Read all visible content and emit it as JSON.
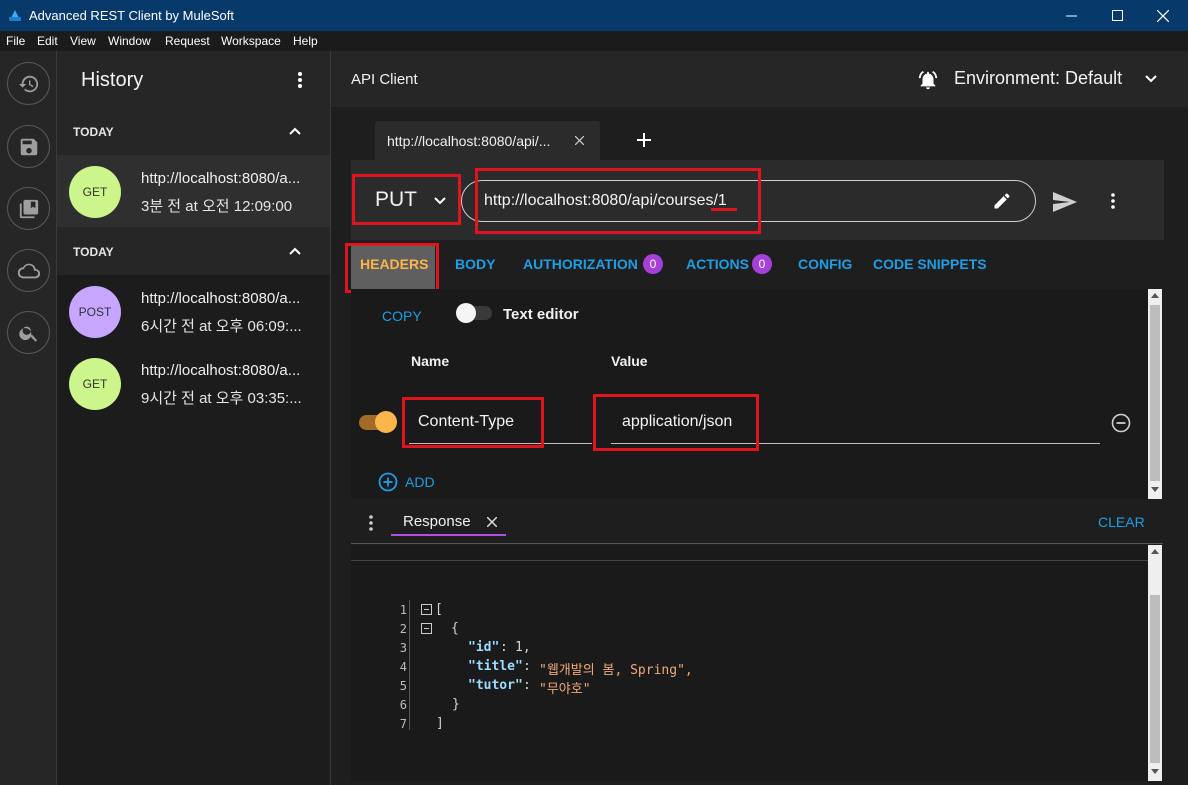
{
  "window": {
    "title": "Advanced REST Client by MuleSoft"
  },
  "menu": [
    "File",
    "Edit",
    "View",
    "Window",
    "Request",
    "Workspace",
    "Help"
  ],
  "history": {
    "title": "History",
    "sections": [
      {
        "label": "TODAY",
        "items": [
          {
            "method": "GET",
            "url": "http://localhost:8080/a...",
            "time": "3분 전 at 오전 12:09:00",
            "color": "#ccf58c"
          }
        ]
      },
      {
        "label": "TODAY",
        "items": [
          {
            "method": "POST",
            "url": "http://localhost:8080/a...",
            "time": "6시간 전 at 오후 06:09:...",
            "color": "#c6a6ff"
          },
          {
            "method": "GET",
            "url": "http://localhost:8080/a...",
            "time": "9시간 전 at 오후 03:35:...",
            "color": "#ccf58c"
          }
        ]
      }
    ]
  },
  "header": {
    "title": "API Client",
    "environment": "Environment: Default"
  },
  "tab": {
    "label": "http://localhost:8080/api/...",
    "add": "+"
  },
  "request": {
    "method": "PUT",
    "url": "http://localhost:8080/api/courses/1"
  },
  "request_tabs": [
    {
      "label": "HEADERS"
    },
    {
      "label": "BODY"
    },
    {
      "label": "AUTHORIZATION",
      "count": "0"
    },
    {
      "label": "ACTIONS",
      "count": "0"
    },
    {
      "label": "CONFIG"
    },
    {
      "label": "CODE SNIPPETS"
    }
  ],
  "headers_panel": {
    "copy": "COPY",
    "text_editor": "Text editor",
    "name_col": "Name",
    "value_col": "Value",
    "row": {
      "name": "Content-Type",
      "value": "application/json"
    },
    "add": "ADD"
  },
  "response": {
    "tab_label": "Response",
    "clear": "CLEAR",
    "lines": [
      {
        "n": "1",
        "text": "["
      },
      {
        "n": "2",
        "text": "{"
      },
      {
        "n": "3",
        "key": "\"id\"",
        "value": "1,"
      },
      {
        "n": "4",
        "key": "\"title\"",
        "value": "\"웹개발의 봄, Spring\","
      },
      {
        "n": "5",
        "key": "\"tutor\"",
        "value": "\"무야호\""
      },
      {
        "n": "6",
        "text": "}"
      },
      {
        "n": "7",
        "text": "]"
      }
    ]
  },
  "colors": {
    "titlebar": "#07396b",
    "accent_blue": "#1e9ee6",
    "headers_active": "#f5a623",
    "highlight_red": "#e0141e",
    "purple_badge": "#a640d8",
    "toggle_orange": "#fbb64b"
  }
}
